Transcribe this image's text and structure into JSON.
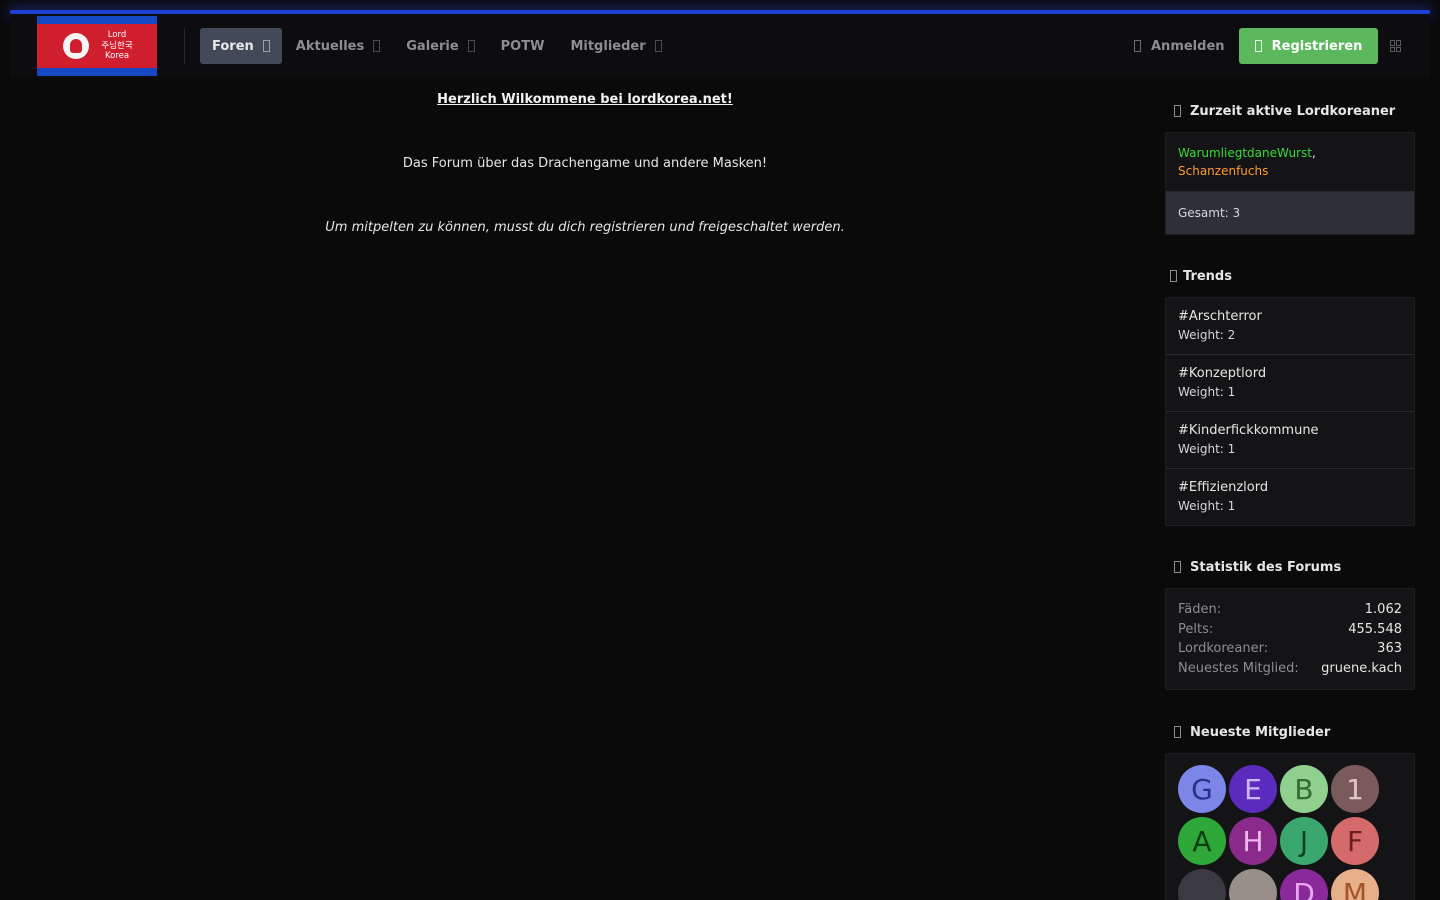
{
  "header": {
    "logo_lines": [
      "Lord",
      "주님한국",
      "Korea"
    ],
    "nav": [
      {
        "label": "Foren",
        "active": true,
        "dropdown": true
      },
      {
        "label": "Aktuelles",
        "active": false,
        "dropdown": true
      },
      {
        "label": "Galerie",
        "active": false,
        "dropdown": true
      },
      {
        "label": "POTW",
        "active": false,
        "dropdown": false
      },
      {
        "label": "Mitglieder",
        "active": false,
        "dropdown": true
      }
    ],
    "login_label": "Anmelden",
    "register_label": "Registrieren",
    "accent_color": "#1f3fd6",
    "register_color": "#5cb85c"
  },
  "main": {
    "welcome": "Herzlich Wilkommene bei lordkorea.net!",
    "subtitle": "Das Forum über das Drachengame und andere Masken!",
    "note": "Um mitpelten zu können, musst du dich registrieren und freigeschaltet werden."
  },
  "sidebar": {
    "online": {
      "title": "Zurzeit aktive Lordkoreaner",
      "user1": "WarumliegtdaneWurst",
      "separator": ",",
      "user2": "Schanzenfuchs",
      "total": "Gesamt: 3"
    },
    "trends": {
      "title": "Trends",
      "items": [
        {
          "tag": "#Arschterror",
          "weight": "Weight: 2"
        },
        {
          "tag": "#Konzeptlord",
          "weight": "Weight: 1"
        },
        {
          "tag": "#Kinderfickkommune",
          "weight": "Weight: 1"
        },
        {
          "tag": "#Effizienzlord",
          "weight": "Weight: 1"
        }
      ]
    },
    "stats": {
      "title": "Statistik des Forums",
      "rows": [
        {
          "key": "Fäden:",
          "value": "1.062"
        },
        {
          "key": "Pelts:",
          "value": "455.548"
        },
        {
          "key": "Lordkoreaner:",
          "value": "363"
        },
        {
          "key": "Neuestes Mitglied:",
          "value": "gruene.kach"
        }
      ]
    },
    "members": {
      "title": "Neueste Mitglieder",
      "avatars": [
        {
          "letter": "G",
          "bg": "#7b86e8",
          "fg": "#2b2f86"
        },
        {
          "letter": "E",
          "bg": "#5a2bbd",
          "fg": "#cdb8ff"
        },
        {
          "letter": "B",
          "bg": "#8fd08f",
          "fg": "#2f6e2f"
        },
        {
          "letter": "1",
          "bg": "#7a5a5a",
          "fg": "#e0c8c8"
        },
        {
          "letter": "A",
          "bg": "#2fa83a",
          "fg": "#0c3d10"
        },
        {
          "letter": "H",
          "bg": "#8a2a8a",
          "fg": "#f0b8f0"
        },
        {
          "letter": "J",
          "bg": "#3aa86e",
          "fg": "#0e3e24"
        },
        {
          "letter": "F",
          "bg": "#d46a6a",
          "fg": "#6e1e1e"
        },
        {
          "letter": "",
          "bg": "#3a3a40",
          "fg": "#3a3a40"
        },
        {
          "letter": "",
          "bg": "#9a8f88",
          "fg": "#9a8f88"
        },
        {
          "letter": "D",
          "bg": "#8a2a9a",
          "fg": "#e8a8f0"
        },
        {
          "letter": "M",
          "bg": "#e8b08a",
          "fg": "#a4542a"
        }
      ]
    }
  }
}
